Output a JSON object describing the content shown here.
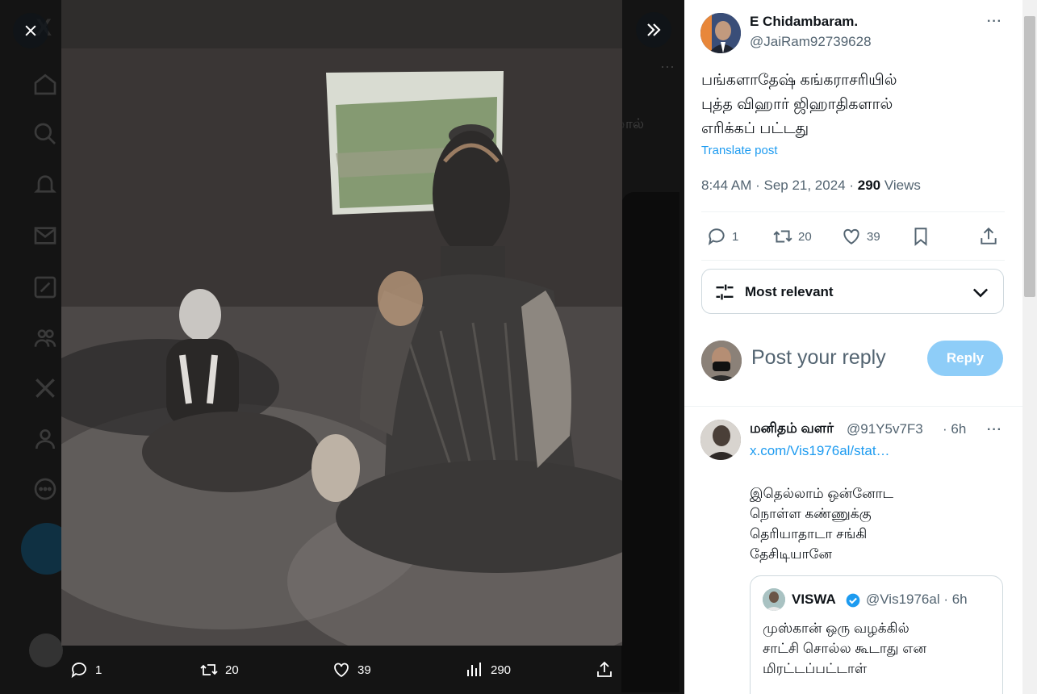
{
  "overlay": {
    "close_icon": "close-icon",
    "expand_icon": "double-chevron-right-icon",
    "photo_description_icon": "photo"
  },
  "media_actions": {
    "replies": "1",
    "reposts": "20",
    "likes": "39",
    "views": "290"
  },
  "background": {
    "partial_text": "ால்",
    "more": "···"
  },
  "post": {
    "author_name": "E Chidambaram.",
    "author_handle": "@JaiRam92739628",
    "text_lines": [
      "பங்களாதேஷ் கங்கராசரியில்",
      "புத்த விஹார் ஜிஹாதிகளால்",
      "எரிக்கப் பட்டது"
    ],
    "translate_label": "Translate post",
    "time": "8:44 AM",
    "date": "Sep 21, 2024",
    "views_count": "290",
    "views_label": "Views",
    "replies": "1",
    "reposts": "20",
    "likes": "39",
    "more": "···"
  },
  "sort": {
    "label": "Most relevant"
  },
  "compose": {
    "placeholder": "Post your reply",
    "button_label": "Reply"
  },
  "reply": {
    "name": "மனிதம் வளர்",
    "handle": "@91Y5v7F3",
    "time": "· 6h",
    "link": "x.com/Vis1976al/stat…",
    "text_lines": [
      "இதெல்லாம் ஒன்னோட",
      "நொள்ள கண்ணுக்கு",
      "தெரியாதாடா சங்கி",
      "தேசிடியானே"
    ],
    "more": "···",
    "quote": {
      "name": "VISWA",
      "handle": "@Vis1976al · 6h",
      "text_lines": [
        "முஸ்கான் ஒரு வழக்கில்",
        "சாட்சி சொல்ல கூடாது என",
        "மிரட்டப்பட்டாள்"
      ]
    }
  },
  "colors": {
    "accent": "#1d9bf0",
    "muted": "#536471",
    "text": "#0f1419",
    "reply_button": "#8ecdf8"
  }
}
